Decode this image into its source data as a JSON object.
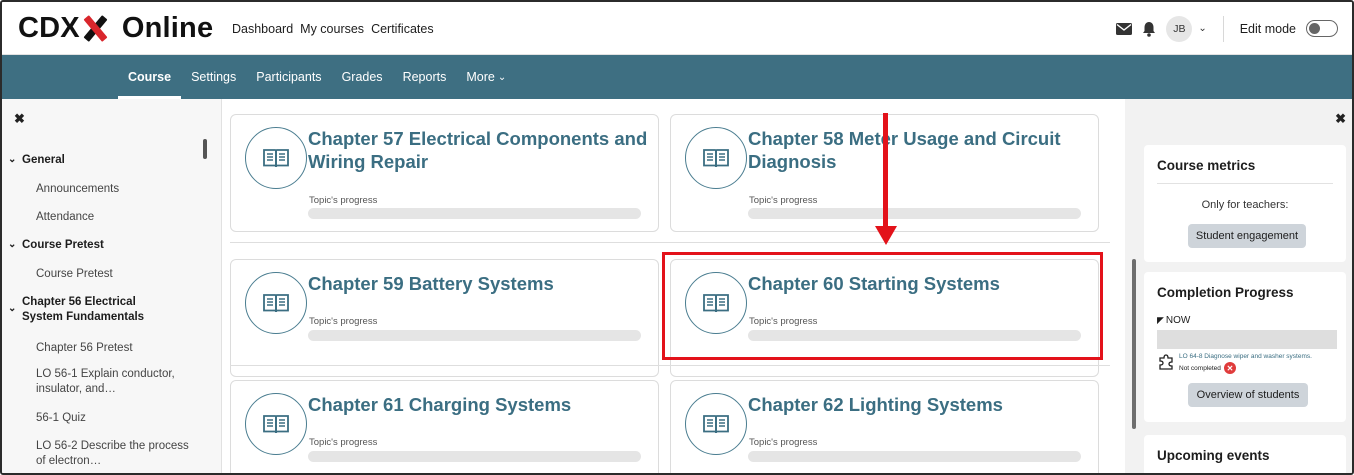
{
  "brand": {
    "part1": "CDX",
    "part2": "Online"
  },
  "topnav": [
    "Dashboard",
    "My courses",
    "Certificates"
  ],
  "user": {
    "initials": "JB",
    "edit_mode_label": "Edit mode"
  },
  "course_nav": {
    "items": [
      "Course",
      "Settings",
      "Participants",
      "Grades",
      "Reports",
      "More"
    ],
    "active": "Course"
  },
  "left_drawer": {
    "items": [
      {
        "type": "section",
        "label": "General"
      },
      {
        "type": "item",
        "label": "Announcements"
      },
      {
        "type": "item",
        "label": "Attendance"
      },
      {
        "type": "section",
        "label": "Course Pretest"
      },
      {
        "type": "item",
        "label": "Course Pretest"
      },
      {
        "type": "section",
        "label": "Chapter 56 Electrical System Fundamentals"
      },
      {
        "type": "item",
        "label": "Chapter 56 Pretest"
      },
      {
        "type": "item",
        "label": "LO 56-1 Explain conductor, insulator, and…"
      },
      {
        "type": "item",
        "label": "56-1 Quiz"
      },
      {
        "type": "item",
        "label": "LO 56-2 Describe the process of electron…"
      }
    ]
  },
  "chapters": [
    {
      "title": "Chapter 57 Electrical Components and Wiring Repair",
      "progress_label": "Topic's progress"
    },
    {
      "title": "Chapter 58 Meter Usage and Circuit Diagnosis",
      "progress_label": "Topic's progress"
    },
    {
      "title": "Chapter 59 Battery Systems",
      "progress_label": "Topic's progress"
    },
    {
      "title": "Chapter 60 Starting Systems",
      "progress_label": "Topic's progress"
    },
    {
      "title": "Chapter 61 Charging Systems",
      "progress_label": "Topic's progress"
    },
    {
      "title": "Chapter 62 Lighting Systems",
      "progress_label": "Topic's progress"
    }
  ],
  "right_drawer": {
    "course_metrics": {
      "title": "Course metrics",
      "note": "Only for teachers:",
      "button": "Student engagement"
    },
    "completion": {
      "title": "Completion Progress",
      "now": "NOW",
      "activity": "LO 64-8 Diagnose wiper and washer systems.",
      "status": "Not completed",
      "button": "Overview of students"
    },
    "upcoming": {
      "title": "Upcoming events"
    }
  },
  "colors": {
    "accent": "#3e6f82",
    "title": "#3b6e82",
    "highlight": "#e3121a"
  }
}
